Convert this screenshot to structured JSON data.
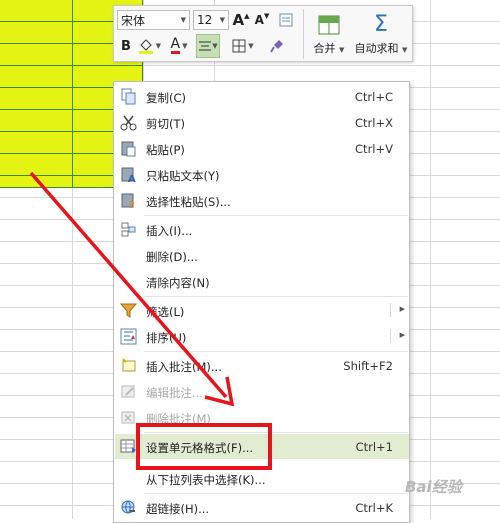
{
  "toolbar": {
    "font_name": "宋体",
    "font_size": "12",
    "grow_font": "A",
    "shrink_font": "A",
    "bold": "B",
    "font_color": "A",
    "merge_label": "合并",
    "autosum_label": "自动求和",
    "autosum_symbol": "Σ"
  },
  "menu": {
    "copy": {
      "label": "复制(C)",
      "shortcut": "Ctrl+C"
    },
    "cut": {
      "label": "剪切(T)",
      "shortcut": "Ctrl+X"
    },
    "paste": {
      "label": "粘贴(P)",
      "shortcut": "Ctrl+V"
    },
    "paste_text": {
      "label": "只粘贴文本(Y)"
    },
    "paste_special": {
      "label": "选择性粘贴(S)..."
    },
    "insert": {
      "label": "插入(I)..."
    },
    "delete": {
      "label": "删除(D)..."
    },
    "clear": {
      "label": "清除内容(N)"
    },
    "filter": {
      "label": "筛选(L)"
    },
    "sort": {
      "label": "排序(U)"
    },
    "insert_comment": {
      "label": "插入批注(M)...",
      "shortcut": "Shift+F2"
    },
    "edit_comment": {
      "label": "编辑批注..."
    },
    "delete_comment": {
      "label": "删除批注(M)"
    },
    "format_cells": {
      "label": "设置单元格格式(F)...",
      "shortcut": "Ctrl+1"
    },
    "pick_from_list": {
      "label": "从下拉列表中选择(K)..."
    },
    "hyperlink": {
      "label": "超链接(H)...",
      "shortcut": "Ctrl+K"
    }
  },
  "watermark": "Bai经验",
  "colors": {
    "cell_fill": "#e5f313",
    "cell_border": "#3d8a2e",
    "highlight": "#e1ecd0",
    "annotation": "#e8141b"
  }
}
